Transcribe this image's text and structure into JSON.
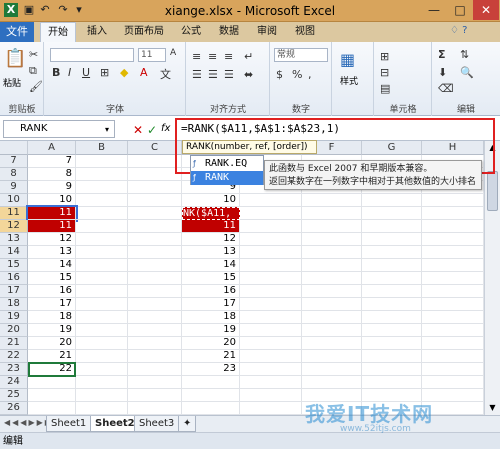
{
  "window": {
    "title": "xiange.xlsx - Microsoft Excel",
    "controls": [
      "—",
      "□",
      "✕"
    ]
  },
  "tabs": [
    "文件",
    "开始",
    "插入",
    "页面布局",
    "公式",
    "数据",
    "审阅",
    "视图"
  ],
  "ribbon": {
    "groups": [
      "剪贴板",
      "字体",
      "对齐方式",
      "数字",
      "单元格",
      "编辑"
    ],
    "paste": "粘贴",
    "font_size": "11",
    "number_format": "常规",
    "styles": "样式"
  },
  "formula_bar": {
    "name_box": "RANK",
    "formula": "=RANK($A11,$A$1:$A$23,1)",
    "fx": "fx"
  },
  "columns": [
    "A",
    "B",
    "C",
    "D",
    "E",
    "F",
    "G",
    "H"
  ],
  "rows": [
    {
      "row": "7",
      "a": "7",
      "d": "7"
    },
    {
      "row": "8",
      "a": "8",
      "d": "8"
    },
    {
      "row": "9",
      "a": "9",
      "d": "9"
    },
    {
      "row": "10",
      "a": "10",
      "d": "10"
    },
    {
      "row": "11",
      "a": "11",
      "d": "NK($A11,"
    },
    {
      "row": "12",
      "a": "11",
      "d": "11"
    },
    {
      "row": "13",
      "a": "12",
      "d": "12"
    },
    {
      "row": "14",
      "a": "13",
      "d": "13"
    },
    {
      "row": "15",
      "a": "14",
      "d": "14"
    },
    {
      "row": "16",
      "a": "15",
      "d": "15"
    },
    {
      "row": "17",
      "a": "16",
      "d": "16"
    },
    {
      "row": "18",
      "a": "17",
      "d": "17"
    },
    {
      "row": "19",
      "a": "18",
      "d": "18"
    },
    {
      "row": "20",
      "a": "19",
      "d": "19"
    },
    {
      "row": "21",
      "a": "20",
      "d": "20"
    },
    {
      "row": "22",
      "a": "21",
      "d": "21"
    },
    {
      "row": "23",
      "a": "22",
      "d": "23"
    },
    {
      "row": "24",
      "a": "",
      "d": ""
    },
    {
      "row": "25",
      "a": "",
      "d": ""
    },
    {
      "row": "26",
      "a": "",
      "d": ""
    }
  ],
  "autocomplete": {
    "hint": "RANK(number, ref, [order])",
    "items": [
      "RANK.EQ",
      "RANK"
    ]
  },
  "tooltip": {
    "line1": "此函数与 Excel 2007 和早期版本兼容。",
    "line2": "返回某数字在一列数字中相对于其他数值的大小排名"
  },
  "sheets": [
    "Sheet1",
    "Sheet2",
    "Sheet3"
  ],
  "status": "编辑",
  "watermark": {
    "text": "我爱IT技术网",
    "url": "www.52itjs.com"
  },
  "colors": {
    "highlight_red": "#c00000",
    "selection_blue": "#3b6fd4",
    "file_tab": "#2e6fc0",
    "callout_red": "#e02020"
  }
}
